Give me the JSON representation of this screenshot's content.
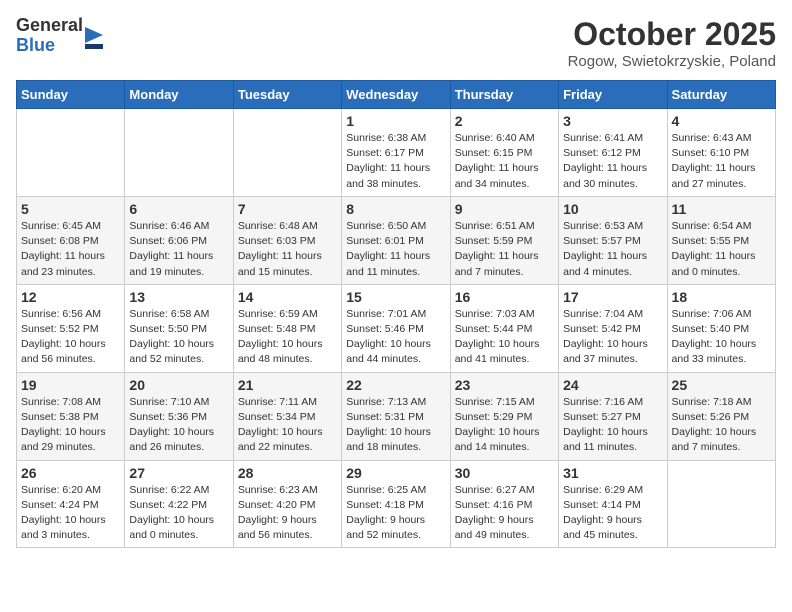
{
  "header": {
    "logo": {
      "general": "General",
      "blue": "Blue"
    },
    "title": "October 2025",
    "subtitle": "Rogow, Swietokrzyskie, Poland"
  },
  "weekdays": [
    "Sunday",
    "Monday",
    "Tuesday",
    "Wednesday",
    "Thursday",
    "Friday",
    "Saturday"
  ],
  "weeks": [
    [
      {
        "day": "",
        "info": ""
      },
      {
        "day": "",
        "info": ""
      },
      {
        "day": "",
        "info": ""
      },
      {
        "day": "1",
        "info": "Sunrise: 6:38 AM\nSunset: 6:17 PM\nDaylight: 11 hours\nand 38 minutes."
      },
      {
        "day": "2",
        "info": "Sunrise: 6:40 AM\nSunset: 6:15 PM\nDaylight: 11 hours\nand 34 minutes."
      },
      {
        "day": "3",
        "info": "Sunrise: 6:41 AM\nSunset: 6:12 PM\nDaylight: 11 hours\nand 30 minutes."
      },
      {
        "day": "4",
        "info": "Sunrise: 6:43 AM\nSunset: 6:10 PM\nDaylight: 11 hours\nand 27 minutes."
      }
    ],
    [
      {
        "day": "5",
        "info": "Sunrise: 6:45 AM\nSunset: 6:08 PM\nDaylight: 11 hours\nand 23 minutes."
      },
      {
        "day": "6",
        "info": "Sunrise: 6:46 AM\nSunset: 6:06 PM\nDaylight: 11 hours\nand 19 minutes."
      },
      {
        "day": "7",
        "info": "Sunrise: 6:48 AM\nSunset: 6:03 PM\nDaylight: 11 hours\nand 15 minutes."
      },
      {
        "day": "8",
        "info": "Sunrise: 6:50 AM\nSunset: 6:01 PM\nDaylight: 11 hours\nand 11 minutes."
      },
      {
        "day": "9",
        "info": "Sunrise: 6:51 AM\nSunset: 5:59 PM\nDaylight: 11 hours\nand 7 minutes."
      },
      {
        "day": "10",
        "info": "Sunrise: 6:53 AM\nSunset: 5:57 PM\nDaylight: 11 hours\nand 4 minutes."
      },
      {
        "day": "11",
        "info": "Sunrise: 6:54 AM\nSunset: 5:55 PM\nDaylight: 11 hours\nand 0 minutes."
      }
    ],
    [
      {
        "day": "12",
        "info": "Sunrise: 6:56 AM\nSunset: 5:52 PM\nDaylight: 10 hours\nand 56 minutes."
      },
      {
        "day": "13",
        "info": "Sunrise: 6:58 AM\nSunset: 5:50 PM\nDaylight: 10 hours\nand 52 minutes."
      },
      {
        "day": "14",
        "info": "Sunrise: 6:59 AM\nSunset: 5:48 PM\nDaylight: 10 hours\nand 48 minutes."
      },
      {
        "day": "15",
        "info": "Sunrise: 7:01 AM\nSunset: 5:46 PM\nDaylight: 10 hours\nand 44 minutes."
      },
      {
        "day": "16",
        "info": "Sunrise: 7:03 AM\nSunset: 5:44 PM\nDaylight: 10 hours\nand 41 minutes."
      },
      {
        "day": "17",
        "info": "Sunrise: 7:04 AM\nSunset: 5:42 PM\nDaylight: 10 hours\nand 37 minutes."
      },
      {
        "day": "18",
        "info": "Sunrise: 7:06 AM\nSunset: 5:40 PM\nDaylight: 10 hours\nand 33 minutes."
      }
    ],
    [
      {
        "day": "19",
        "info": "Sunrise: 7:08 AM\nSunset: 5:38 PM\nDaylight: 10 hours\nand 29 minutes."
      },
      {
        "day": "20",
        "info": "Sunrise: 7:10 AM\nSunset: 5:36 PM\nDaylight: 10 hours\nand 26 minutes."
      },
      {
        "day": "21",
        "info": "Sunrise: 7:11 AM\nSunset: 5:34 PM\nDaylight: 10 hours\nand 22 minutes."
      },
      {
        "day": "22",
        "info": "Sunrise: 7:13 AM\nSunset: 5:31 PM\nDaylight: 10 hours\nand 18 minutes."
      },
      {
        "day": "23",
        "info": "Sunrise: 7:15 AM\nSunset: 5:29 PM\nDaylight: 10 hours\nand 14 minutes."
      },
      {
        "day": "24",
        "info": "Sunrise: 7:16 AM\nSunset: 5:27 PM\nDaylight: 10 hours\nand 11 minutes."
      },
      {
        "day": "25",
        "info": "Sunrise: 7:18 AM\nSunset: 5:26 PM\nDaylight: 10 hours\nand 7 minutes."
      }
    ],
    [
      {
        "day": "26",
        "info": "Sunrise: 6:20 AM\nSunset: 4:24 PM\nDaylight: 10 hours\nand 3 minutes."
      },
      {
        "day": "27",
        "info": "Sunrise: 6:22 AM\nSunset: 4:22 PM\nDaylight: 10 hours\nand 0 minutes."
      },
      {
        "day": "28",
        "info": "Sunrise: 6:23 AM\nSunset: 4:20 PM\nDaylight: 9 hours\nand 56 minutes."
      },
      {
        "day": "29",
        "info": "Sunrise: 6:25 AM\nSunset: 4:18 PM\nDaylight: 9 hours\nand 52 minutes."
      },
      {
        "day": "30",
        "info": "Sunrise: 6:27 AM\nSunset: 4:16 PM\nDaylight: 9 hours\nand 49 minutes."
      },
      {
        "day": "31",
        "info": "Sunrise: 6:29 AM\nSunset: 4:14 PM\nDaylight: 9 hours\nand 45 minutes."
      },
      {
        "day": "",
        "info": ""
      }
    ]
  ]
}
